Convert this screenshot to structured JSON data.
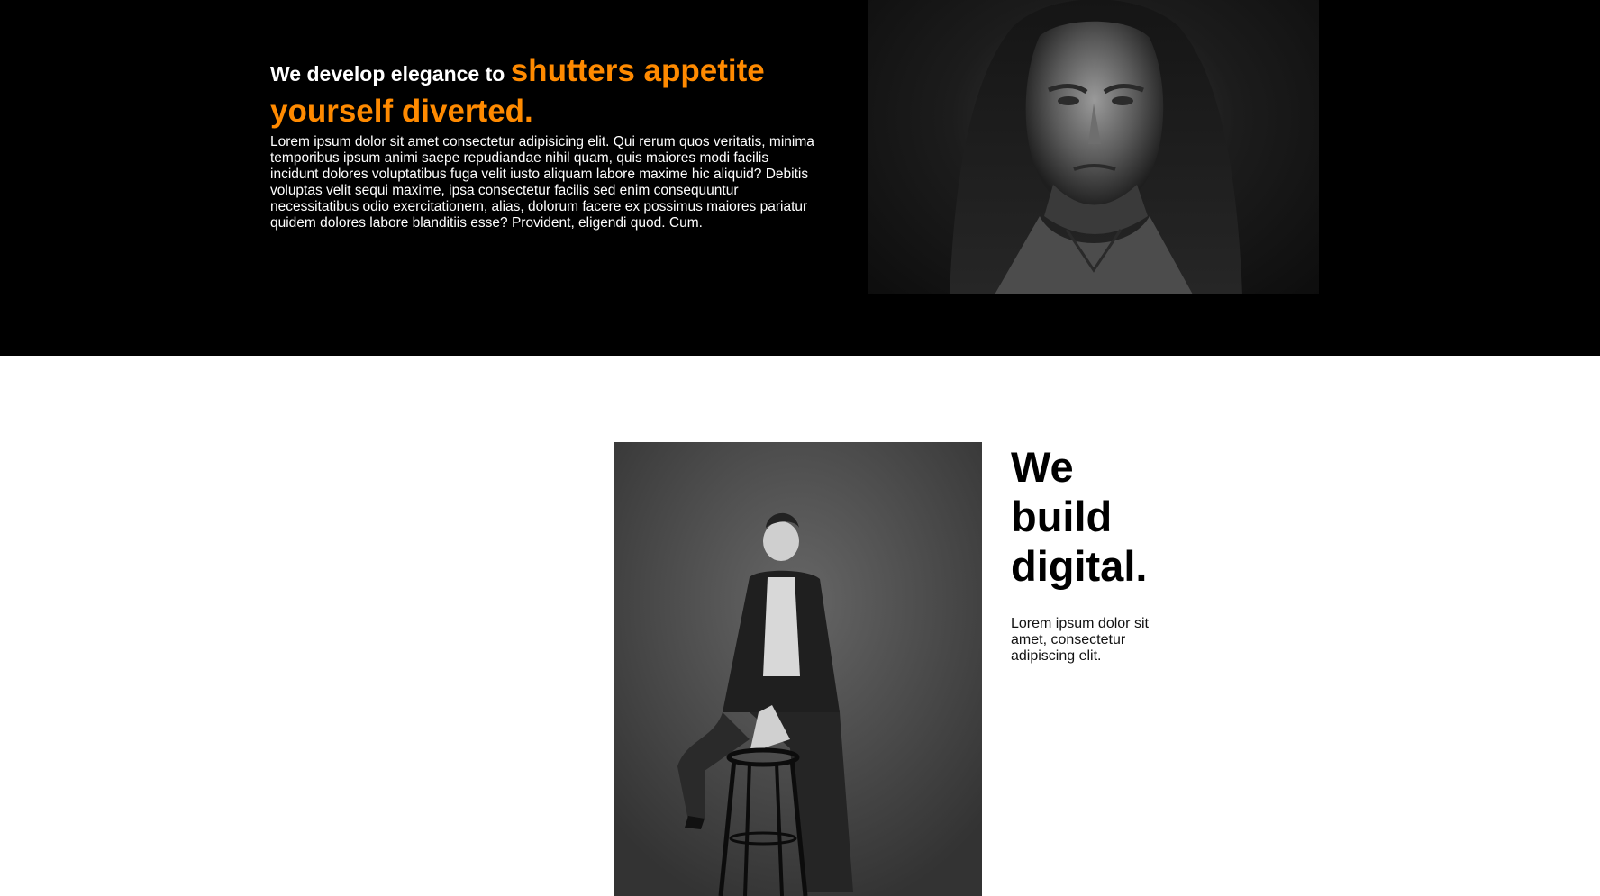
{
  "hero": {
    "heading_lead": "We develop elegance to ",
    "heading_accent": "shutters appetite yourself diverted.",
    "body": "Lorem ipsum dolor sit amet consectetur adipisicing elit. Qui rerum quos veritatis, minima temporibus ipsum animi saepe repudiandae nihil quam, quis maiores modi facilis incidunt dolores voluptatibus fuga velit iusto aliquam labore maxime hic aliquid? Debitis voluptas velit sequi maxime, ipsa consectetur facilis sed enim consequuntur necessitatibus odio exercitationem, alias, dolorum facere ex possimus maiores pariatur quidem dolores labore blanditiis esse? Provident, eligendi quod. Cum.",
    "accent_color": "#ff8a00",
    "background_color": "#000000",
    "photo": "portrait-photo"
  },
  "feature": {
    "heading": "We build digital.",
    "body": "Lorem ipsum dolor sit amet, consectetur adipiscing elit.",
    "photo": "model-on-stool-photo"
  }
}
